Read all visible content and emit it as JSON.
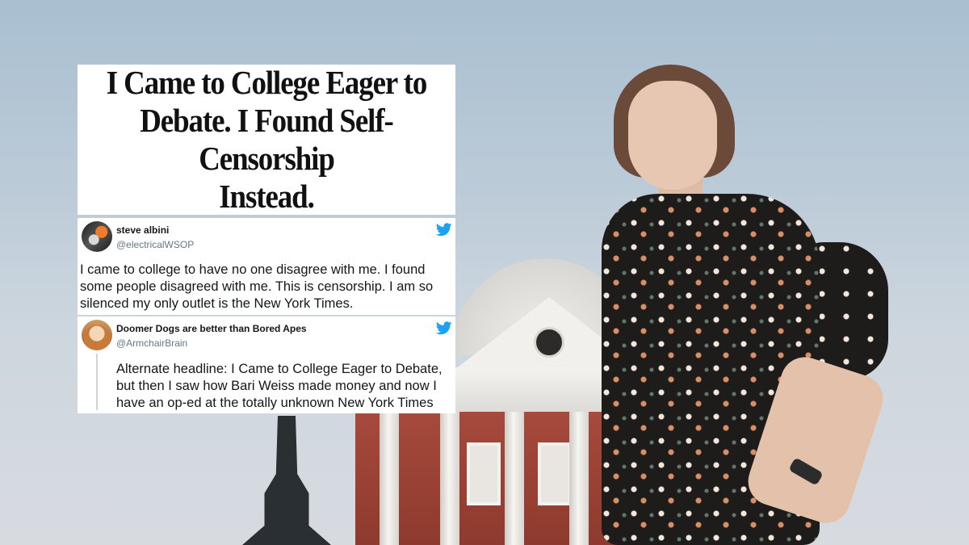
{
  "headline": {
    "line1": "I Came to College Eager to",
    "line2": "Debate. I Found Self-Censorship",
    "line3": "Instead."
  },
  "tweets": [
    {
      "name": "steve albini",
      "handle": "@electricalWSOP",
      "text": "I came to college to have no one disagree with me. I found some people disagreed with me. This is censorship. I am so silenced my only outlet is the New York Times.",
      "icon": "twitter-bird-icon"
    },
    {
      "name": "Doomer Dogs are better than Bored Apes",
      "handle": "@ArmchairBrain",
      "text": "Alternate headline: I Came to College Eager to Debate, but then I saw how Bari Weiss made money and now I have an op-ed at the totally unknown New York Times",
      "icon": "twitter-bird-icon"
    }
  ],
  "colors": {
    "twitter_blue": "#1da1f2",
    "card_bg": "#ffffff",
    "handle_gray": "#657786"
  }
}
